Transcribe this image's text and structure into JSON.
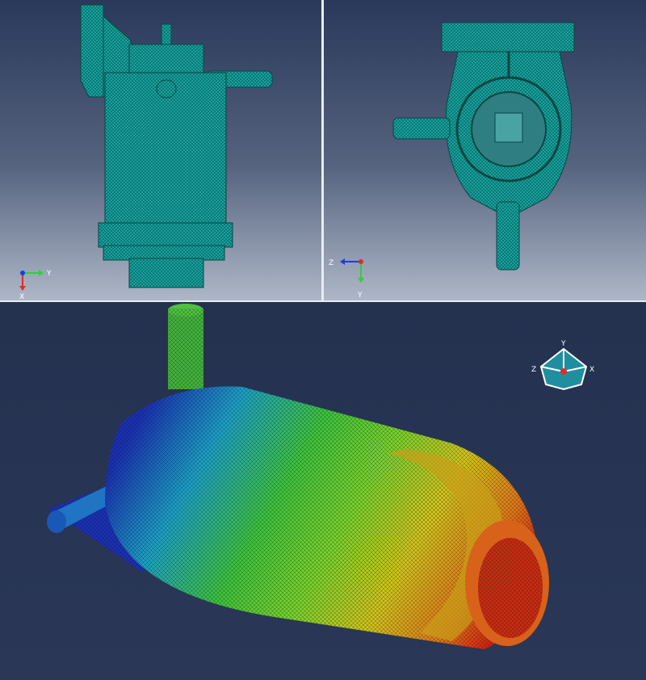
{
  "views": {
    "top_left": {
      "name": "side-view-mesh",
      "triad": {
        "axis_a": "Y",
        "axis_b": "X"
      }
    },
    "top_right": {
      "name": "end-view-mesh",
      "triad": {
        "axis_a": "Z",
        "axis_b": "Y"
      }
    },
    "bottom": {
      "name": "isometric-contour",
      "triad": {
        "axis_up": "Y",
        "axis_left": "Z",
        "axis_right": "X"
      }
    }
  },
  "colors": {
    "mesh": "#12a7a2",
    "mesh_line": "#0a4e4d",
    "background_top": "#263452",
    "background_bottom": "#aab3c3",
    "contour_low": "#1a2fb4",
    "contour_mid": "#5ccb2c",
    "contour_high": "#d21a0e"
  },
  "icons": [
    "axis-triad-icon",
    "view-cube-icon"
  ]
}
